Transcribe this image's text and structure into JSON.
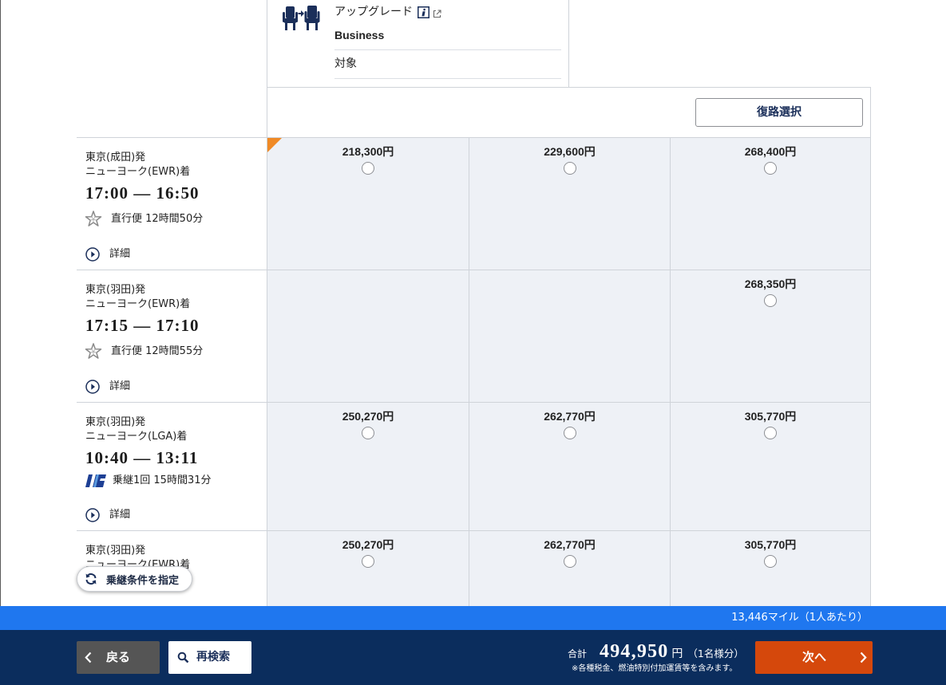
{
  "upgrade": {
    "icon": "seat-upgrade-icon",
    "title": "アップグレード",
    "class_name": "Business",
    "status": "対象"
  },
  "return_select_label": "復路選択",
  "flights": [
    {
      "depart": "東京(成田)発",
      "arrive": "ニューヨーク(EWR)着",
      "time": "17:00 — 16:50",
      "carrier_icon": "star-alliance-icon",
      "summary": "直行便 12時間50分",
      "details_label": "詳細",
      "fares": [
        "218,300円",
        "229,600円",
        "268,400円"
      ]
    },
    {
      "depart": "東京(羽田)発",
      "arrive": "ニューヨーク(EWR)着",
      "time": "17:15 — 17:10",
      "carrier_icon": "star-alliance-icon",
      "summary": "直行便 12時間55分",
      "details_label": "詳細",
      "fares": [
        "",
        "",
        "268,350円"
      ]
    },
    {
      "depart": "東京(羽田)発",
      "arrive": "ニューヨーク(LGA)着",
      "time": "10:40 — 13:11",
      "carrier_icon": "ana-airline-icon",
      "summary": "乗継1回 15時間31分",
      "details_label": "詳細",
      "fares": [
        "250,270円",
        "262,770円",
        "305,770円"
      ]
    },
    {
      "depart": "東京(羽田)発",
      "arrive": "ニューヨーク(EWR)着",
      "fares": [
        "250,270円",
        "262,770円",
        "305,770円"
      ]
    }
  ],
  "connection_filter_label": "乗継条件を指定",
  "miles_text": "13,446マイル（1人あたり）",
  "footer": {
    "back_label": "戻る",
    "research_label": "再検索",
    "total_label": "合計",
    "total_amount": "494,950",
    "currency": "円",
    "passenger_note": "（1名様分）",
    "tax_note": "※各種税金、燃油特別付加運賃等を含みます。",
    "next_label": "次へ"
  },
  "colors": {
    "navy": "#0b2d5d",
    "miles_bar": "#1f77ef",
    "next_button": "#d5480c",
    "back_button": "#555555",
    "fare_cell_bg": "#eef1f6",
    "corner_marker": "#f08a26"
  }
}
